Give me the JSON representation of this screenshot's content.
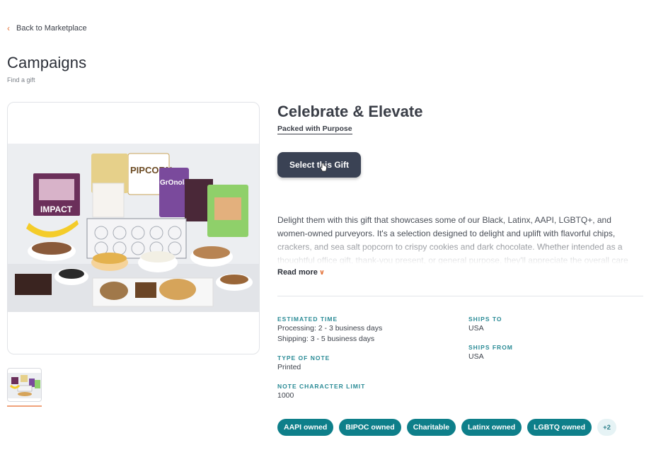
{
  "nav": {
    "back_label": "Back to Marketplace",
    "back_icon": "chevron-left-icon"
  },
  "header": {
    "title": "Campaigns",
    "subtitle": "Find a gift"
  },
  "gift": {
    "title": "Celebrate & Elevate",
    "vendor": "Packed with Purpose",
    "select_label": "Select this Gift",
    "description": "Delight them with this gift that showcases some of our Black, Latinx, AAPI, LGBTQ+, and women-owned purveyors. It's a selection designed to delight and uplift with flavorful chips, crackers, and sea salt popcorn to crispy cookies and dark chocolate. Whether intended as a thoughtful office gift, thank-you present, or general purpose, they'll appreciate the overall care",
    "read_more_label": "Read more"
  },
  "details": {
    "estimated_time_label": "ESTIMATED TIME",
    "processing": "Processing: 2 - 3 business days",
    "shipping": "Shipping: 3 - 5 business days",
    "type_of_note_label": "TYPE OF NOTE",
    "type_of_note": "Printed",
    "note_limit_label": "NOTE CHARACTER LIMIT",
    "note_limit": "1000",
    "ships_to_label": "SHIPS TO",
    "ships_to": "USA",
    "ships_from_label": "SHIPS FROM",
    "ships_from": "USA"
  },
  "tags": [
    "AAPI owned",
    "BIPOC owned",
    "Charitable",
    "Latinx owned",
    "LGBTQ owned"
  ],
  "tags_more": "+2",
  "colors": {
    "accent": "#e4733a",
    "teal": "#0e7f8a",
    "button": "#3a4254"
  },
  "image_text": {
    "popcorn": "PIPCORN",
    "impact": "IMPACT",
    "granola": "GrOnola"
  }
}
